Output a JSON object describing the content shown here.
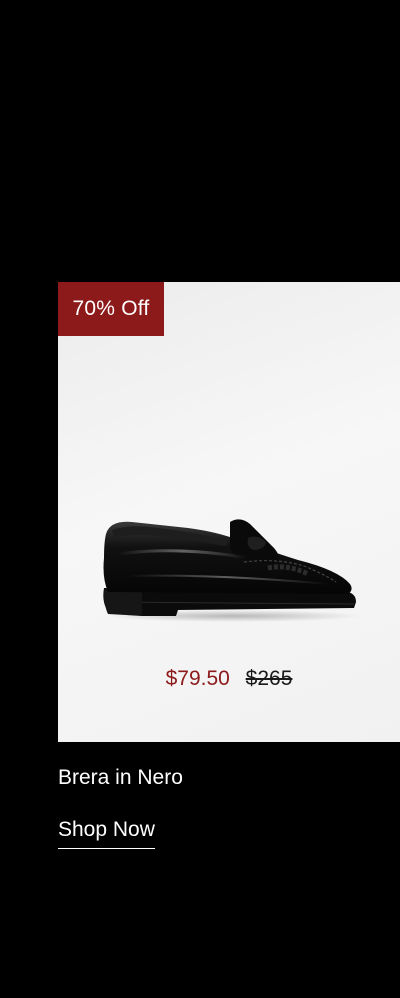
{
  "product": {
    "discount_badge": "70% Off",
    "sale_price": "$79.50",
    "original_price": "$265",
    "name": "Brera in Nero",
    "image_name": "black-penny-loafer-image",
    "cta_label": "Shop Now"
  },
  "colors": {
    "page_background": "#000000",
    "badge_background": "#8c1a1a",
    "sale_price": "#8c1a1a",
    "card_background": "#f2f2f2",
    "text_light": "#ffffff"
  }
}
